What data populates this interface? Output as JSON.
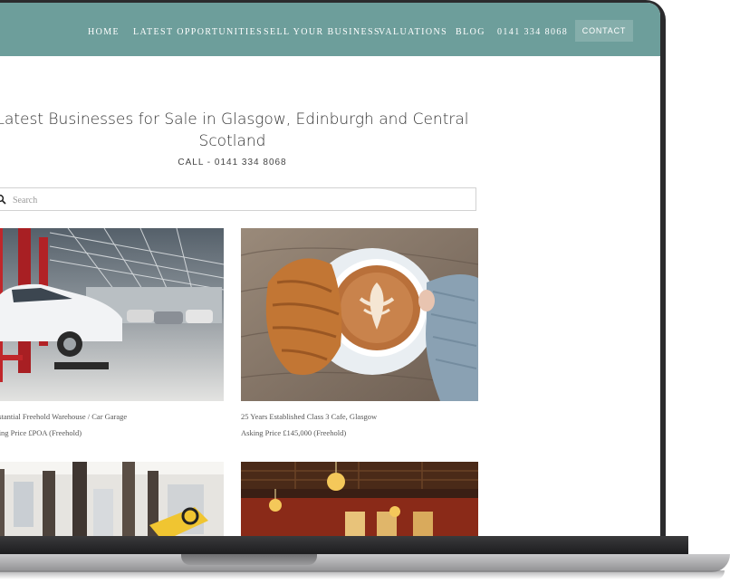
{
  "nav": {
    "items": [
      "HOME",
      "LATEST OPPORTUNITIES",
      "SELL YOUR BUSINESS",
      "VALUATIONS",
      "BLOG",
      "0141 334 8068"
    ],
    "contact_label": "CONTACT",
    "bg_color": "#6d9e9b"
  },
  "page": {
    "title": "Latest Businesses for Sale in Glasgow, Edinburgh and Central Scotland",
    "call": "CALL - 0141 334 8068"
  },
  "search": {
    "placeholder": "Search",
    "icon": "search-icon"
  },
  "listings": [
    {
      "title": "Substantial Freehold Warehouse / Car Garage",
      "price": "Asking Price £POA (Freehold)",
      "image": "car-garage-photo"
    },
    {
      "title": "25 Years Established Class 3 Cafe, Glasgow",
      "price": "Asking Price £145,000 (Freehold)",
      "image": "coffee-croissant-photo"
    },
    {
      "title": "",
      "price": "",
      "image": "marble-hall-photo"
    },
    {
      "title": "",
      "price": "",
      "image": "ballroom-photo"
    }
  ]
}
